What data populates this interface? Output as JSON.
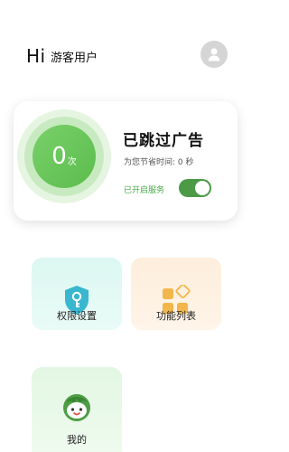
{
  "header": {
    "hi": "Hi",
    "username": "游客用户"
  },
  "stats": {
    "count": "0",
    "count_unit": "次",
    "title": "已跳过广告",
    "saved_time": "为您节省时间: 0 秒",
    "service_label": "已开启服务",
    "service_enabled": true
  },
  "tiles": [
    {
      "label": "权限设置",
      "icon": "shield-key-icon"
    },
    {
      "label": "功能列表",
      "icon": "grid-blocks-icon"
    },
    {
      "label": "我的",
      "icon": "mascot-face-icon"
    }
  ],
  "colors": {
    "accent_green": "#5cbd4d",
    "toggle_green": "#4c9a46",
    "teal_icon": "#38b7cf",
    "orange_icon": "#f2b64b"
  }
}
